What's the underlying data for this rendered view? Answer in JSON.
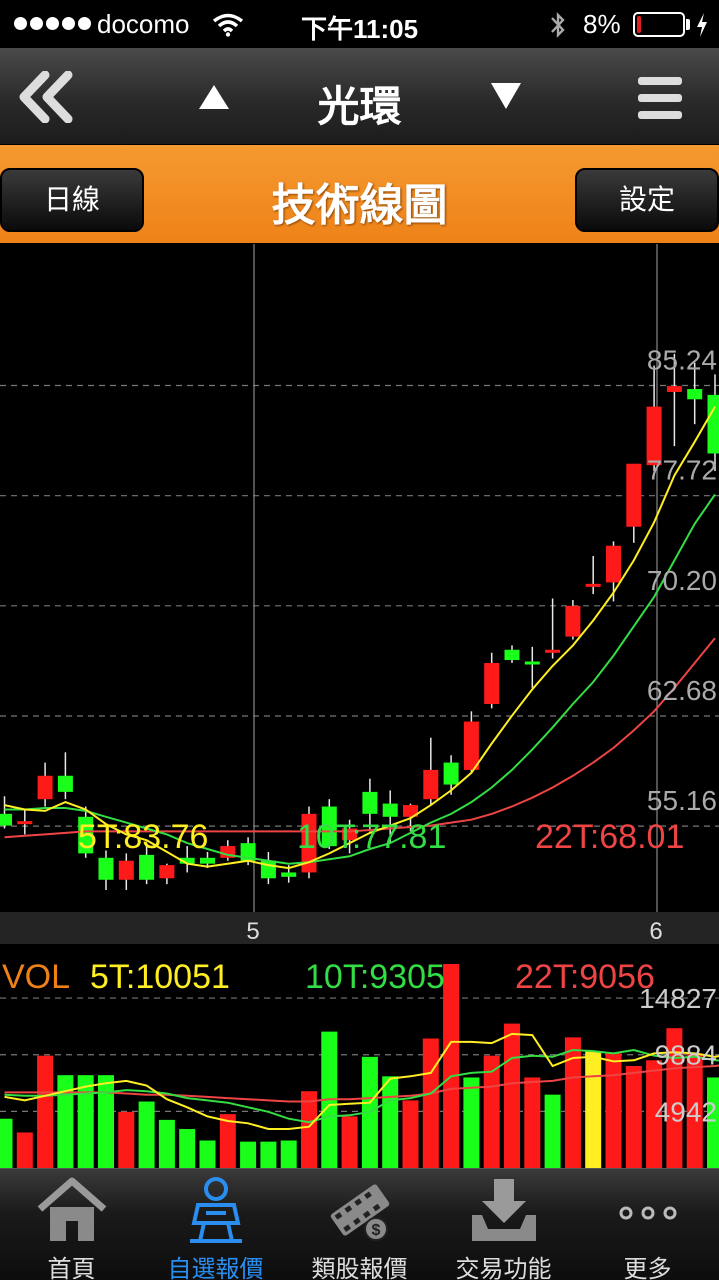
{
  "status_bar": {
    "carrier": "docomo",
    "time": "下午11:05",
    "battery_percent": "8%",
    "battery_level": 0.08
  },
  "nav": {
    "title": "光環",
    "back_icon": "double-chevron-left-icon",
    "menu_icon": "hamburger-menu-icon"
  },
  "header": {
    "title": "技術線圖",
    "period_button": "日線",
    "settings_button": "設定",
    "accent_color": "#ee8218"
  },
  "kline_labels": {
    "ma5": "5T:83.76",
    "ma10": "10T:77.81",
    "ma22": "22T:68.01"
  },
  "volume_labels": {
    "title": "VOL",
    "ma5": "5T:10051",
    "ma10": "10T:9305",
    "ma22": "22T:9056"
  },
  "chart_data": [
    {
      "type": "candlestick",
      "x_ticks": [
        "5",
        "6"
      ],
      "y_ticks": [
        "85.24",
        "77.72",
        "70.20",
        "62.68",
        "55.16"
      ],
      "ylim": [
        49.3,
        94.9
      ],
      "colors": {
        "up": "#ff1a1a",
        "down": "#1aff1a",
        "ma5": "#ffee22",
        "ma10": "#33dd44",
        "ma22": "#ee4444"
      },
      "candles": [
        {
          "o": 56.0,
          "h": 57.2,
          "l": 55.0,
          "c": 55.2
        },
        {
          "o": 55.3,
          "h": 56.3,
          "l": 54.6,
          "c": 55.5
        },
        {
          "o": 57.0,
          "h": 59.5,
          "l": 56.5,
          "c": 58.6
        },
        {
          "o": 58.6,
          "h": 60.2,
          "l": 57.0,
          "c": 57.5
        },
        {
          "o": 55.8,
          "h": 56.5,
          "l": 53.0,
          "c": 53.3
        },
        {
          "o": 53.0,
          "h": 53.5,
          "l": 50.8,
          "c": 51.5
        },
        {
          "o": 51.5,
          "h": 53.3,
          "l": 50.8,
          "c": 52.8
        },
        {
          "o": 53.2,
          "h": 54.0,
          "l": 51.2,
          "c": 51.5
        },
        {
          "o": 51.6,
          "h": 52.6,
          "l": 51.2,
          "c": 52.5
        },
        {
          "o": 53.0,
          "h": 53.8,
          "l": 52.0,
          "c": 52.6
        },
        {
          "o": 53.0,
          "h": 53.4,
          "l": 52.3,
          "c": 52.6
        },
        {
          "o": 53.0,
          "h": 54.2,
          "l": 52.8,
          "c": 53.8
        },
        {
          "o": 54.0,
          "h": 54.4,
          "l": 52.5,
          "c": 52.8
        },
        {
          "o": 52.8,
          "h": 53.4,
          "l": 51.2,
          "c": 51.6
        },
        {
          "o": 52.0,
          "h": 52.5,
          "l": 51.3,
          "c": 51.7
        },
        {
          "o": 52.0,
          "h": 56.5,
          "l": 51.6,
          "c": 56.0
        },
        {
          "o": 56.5,
          "h": 57.0,
          "l": 53.6,
          "c": 53.8
        },
        {
          "o": 54.2,
          "h": 55.6,
          "l": 53.3,
          "c": 55.0
        },
        {
          "o": 57.5,
          "h": 58.4,
          "l": 54.8,
          "c": 56.0
        },
        {
          "o": 56.7,
          "h": 57.6,
          "l": 54.0,
          "c": 55.8
        },
        {
          "o": 55.8,
          "h": 56.7,
          "l": 54.8,
          "c": 56.6
        },
        {
          "o": 57.0,
          "h": 61.2,
          "l": 56.6,
          "c": 59.0
        },
        {
          "o": 59.5,
          "h": 60.0,
          "l": 57.3,
          "c": 58.0
        },
        {
          "o": 59.0,
          "h": 63.0,
          "l": 58.8,
          "c": 62.3
        },
        {
          "o": 63.5,
          "h": 67.0,
          "l": 63.2,
          "c": 66.3
        },
        {
          "o": 67.2,
          "h": 67.5,
          "l": 66.3,
          "c": 66.5
        },
        {
          "o": 66.4,
          "h": 67.4,
          "l": 64.6,
          "c": 66.2
        },
        {
          "o": 67.0,
          "h": 70.7,
          "l": 66.6,
          "c": 67.2
        },
        {
          "o": 68.1,
          "h": 70.6,
          "l": 67.9,
          "c": 70.2
        },
        {
          "o": 71.6,
          "h": 73.6,
          "l": 71.0,
          "c": 71.7
        },
        {
          "o": 71.8,
          "h": 74.6,
          "l": 70.5,
          "c": 74.3
        },
        {
          "o": 75.6,
          "h": 79.6,
          "l": 74.5,
          "c": 79.9
        },
        {
          "o": 79.8,
          "h": 86.6,
          "l": 79.4,
          "c": 83.8
        },
        {
          "o": 84.8,
          "h": 87.4,
          "l": 81.1,
          "c": 85.2
        },
        {
          "o": 85.0,
          "h": 86.8,
          "l": 82.6,
          "c": 84.3
        },
        {
          "o": 84.6,
          "h": 86.0,
          "l": 79.4,
          "c": 80.6
        }
      ],
      "ma5": [
        56.6,
        56.3,
        56.2,
        56.8,
        56.3,
        55.3,
        54.6,
        54.2,
        53.4,
        52.6,
        52.4,
        52.6,
        52.8,
        52.5,
        52.3,
        52.7,
        53.3,
        54.0,
        54.7,
        55.2,
        55.7,
        56.6,
        57.6,
        58.8,
        60.8,
        62.7,
        64.5,
        66.1,
        67.5,
        69.2,
        71.1,
        73.3,
        75.9,
        79.1,
        81.4,
        83.8
      ],
      "ma10": [
        56.3,
        56.3,
        56.4,
        56.4,
        56.2,
        55.8,
        55.4,
        55.0,
        54.6,
        54.0,
        53.6,
        53.2,
        53.0,
        52.8,
        52.6,
        52.7,
        52.9,
        53.1,
        53.6,
        54.0,
        54.7,
        55.4,
        56.0,
        56.8,
        57.8,
        59.0,
        60.4,
        61.9,
        63.5,
        65.0,
        66.8,
        68.8,
        70.8,
        73.3,
        75.8,
        77.8
      ],
      "ma22": [
        54.4,
        54.5,
        54.6,
        54.7,
        54.8,
        54.8,
        54.8,
        54.8,
        54.8,
        54.8,
        54.8,
        54.8,
        54.8,
        54.8,
        54.8,
        54.8,
        54.8,
        54.8,
        54.9,
        55.0,
        55.1,
        55.2,
        55.4,
        55.6,
        56.0,
        56.5,
        57.1,
        57.8,
        58.6,
        59.5,
        60.5,
        61.7,
        63.0,
        64.6,
        66.3,
        68.0
      ]
    },
    {
      "type": "bar",
      "title": "VOL",
      "y_ticks": [
        "14827",
        "9884",
        "4942"
      ],
      "ylim": [
        0,
        17800
      ],
      "highlight_color": "#ffee22",
      "volumes": [
        4300,
        3100,
        9800,
        8100,
        8100,
        8100,
        4900,
        5800,
        4200,
        3400,
        2400,
        4700,
        2300,
        2300,
        2400,
        6700,
        11900,
        4500,
        9700,
        8000,
        5900,
        11300,
        20000,
        7900,
        9800,
        12600,
        7900,
        6400,
        11400,
        10200,
        10000,
        8900,
        9400,
        12200,
        10000,
        7900,
        7600
      ],
      "up": [
        false,
        true,
        true,
        false,
        false,
        false,
        true,
        false,
        false,
        false,
        false,
        true,
        false,
        false,
        false,
        true,
        false,
        true,
        false,
        false,
        true,
        true,
        true,
        false,
        true,
        true,
        true,
        false,
        true,
        true,
        true,
        true,
        true,
        true,
        true,
        false,
        false
      ],
      "ma5": [
        6200,
        5900,
        6300,
        6700,
        7100,
        7400,
        7600,
        7200,
        6000,
        5300,
        4500,
        4100,
        3900,
        3400,
        3400,
        3600,
        5500,
        5600,
        5700,
        7800,
        8000,
        8300,
        11000,
        11000,
        10900,
        11700,
        11600,
        8900,
        9600,
        9700,
        9300,
        9400,
        10000,
        10100,
        10000,
        9700,
        10000
      ],
      "ma10": [
        6400,
        6300,
        6300,
        6400,
        6500,
        6600,
        6800,
        6700,
        6500,
        6100,
        5900,
        5700,
        5300,
        4900,
        4300,
        4000,
        4500,
        4600,
        4900,
        5900,
        6100,
        6500,
        8000,
        8300,
        8400,
        9600,
        9800,
        9700,
        10300,
        10200,
        10000,
        10300,
        9800,
        9600,
        9700,
        9400,
        9300
      ],
      "ma22": [
        6600,
        6600,
        6600,
        6600,
        6600,
        6600,
        6500,
        6400,
        6400,
        6300,
        6200,
        6100,
        6000,
        5900,
        5800,
        5800,
        6000,
        6000,
        6100,
        6200,
        6300,
        6500,
        6900,
        7000,
        7100,
        7400,
        7500,
        7600,
        7900,
        8000,
        8100,
        8300,
        8500,
        8700,
        8800,
        8900,
        9100
      ]
    }
  ],
  "tabs": [
    {
      "label": "首頁",
      "icon": "home-icon"
    },
    {
      "label": "自選報價",
      "icon": "watchlist-person-icon"
    },
    {
      "label": "類股報價",
      "icon": "film-dollar-icon"
    },
    {
      "label": "交易功能",
      "icon": "download-tray-icon"
    },
    {
      "label": "更多",
      "icon": "more-dots-icon"
    }
  ],
  "active_tab": 1
}
